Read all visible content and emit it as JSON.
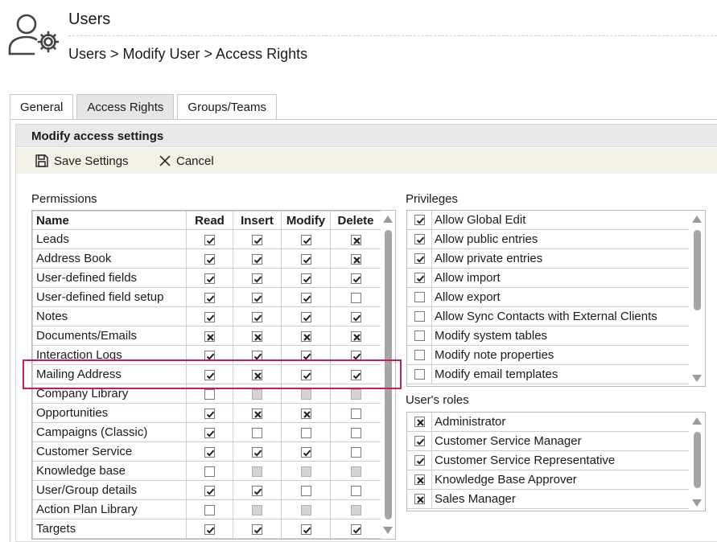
{
  "header": {
    "title": "Users",
    "breadcrumb": "Users > Modify User > Access Rights"
  },
  "tabs": [
    {
      "label": "General",
      "active": false
    },
    {
      "label": "Access Rights",
      "active": true
    },
    {
      "label": "Groups/Teams",
      "active": false
    }
  ],
  "panel": {
    "title": "Modify access settings",
    "save_label": "Save Settings",
    "cancel_label": "Cancel"
  },
  "permissions": {
    "label": "Permissions",
    "columns": [
      "Name",
      "Read",
      "Insert",
      "Modify",
      "Delete"
    ],
    "state_legend": {
      "c": "checked",
      "x": "crossed",
      "u": "unchecked",
      "d": "disabled"
    },
    "rows": [
      {
        "name": "Leads",
        "read": "c",
        "insert": "c",
        "modify": "c",
        "delete": "x"
      },
      {
        "name": "Address Book",
        "read": "c",
        "insert": "c",
        "modify": "c",
        "delete": "x"
      },
      {
        "name": "User-defined fields",
        "read": "c",
        "insert": "c",
        "modify": "c",
        "delete": "c"
      },
      {
        "name": "User-defined field setup",
        "read": "c",
        "insert": "c",
        "modify": "c",
        "delete": "u"
      },
      {
        "name": "Notes",
        "read": "c",
        "insert": "c",
        "modify": "c",
        "delete": "c"
      },
      {
        "name": "Documents/Emails",
        "read": "x",
        "insert": "x",
        "modify": "x",
        "delete": "x"
      },
      {
        "name": "Interaction Logs",
        "read": "c",
        "insert": "c",
        "modify": "c",
        "delete": "c"
      },
      {
        "name": "Mailing Address",
        "read": "c",
        "insert": "x",
        "modify": "c",
        "delete": "c"
      },
      {
        "name": "Company Library",
        "read": "u",
        "insert": "d",
        "modify": "d",
        "delete": "d"
      },
      {
        "name": "Opportunities",
        "read": "c",
        "insert": "x",
        "modify": "x",
        "delete": "u"
      },
      {
        "name": "Campaigns (Classic)",
        "read": "c",
        "insert": "u",
        "modify": "u",
        "delete": "u"
      },
      {
        "name": "Customer Service",
        "read": "c",
        "insert": "c",
        "modify": "c",
        "delete": "u"
      },
      {
        "name": "Knowledge base",
        "read": "u",
        "insert": "d",
        "modify": "d",
        "delete": "d"
      },
      {
        "name": "User/Group details",
        "read": "c",
        "insert": "c",
        "modify": "u",
        "delete": "u"
      },
      {
        "name": "Action Plan Library",
        "read": "u",
        "insert": "d",
        "modify": "d",
        "delete": "d"
      },
      {
        "name": "Targets",
        "read": "c",
        "insert": "c",
        "modify": "c",
        "delete": "c"
      }
    ]
  },
  "privileges": {
    "label": "Privileges",
    "items": [
      {
        "label": "Allow Global Edit",
        "state": "c"
      },
      {
        "label": "Allow public entries",
        "state": "c"
      },
      {
        "label": "Allow private entries",
        "state": "c"
      },
      {
        "label": "Allow import",
        "state": "c"
      },
      {
        "label": "Allow export",
        "state": "u"
      },
      {
        "label": "Allow Sync Contacts with External Clients",
        "state": "u"
      },
      {
        "label": "Modify system tables",
        "state": "u"
      },
      {
        "label": "Modify note properties",
        "state": "u"
      },
      {
        "label": "Modify email templates",
        "state": "u"
      }
    ]
  },
  "roles": {
    "label": "User's roles",
    "items": [
      {
        "label": "Administrator",
        "state": "x"
      },
      {
        "label": "Customer Service Manager",
        "state": "c"
      },
      {
        "label": "Customer Service Representative",
        "state": "c"
      },
      {
        "label": "Knowledge Base Approver",
        "state": "x"
      },
      {
        "label": "Sales Manager",
        "state": "x"
      }
    ]
  },
  "colors": {
    "highlight": "#c3224e",
    "panel_header": "#e9e9e9",
    "toolbar": "#f4f1e8",
    "active_tab": "#e6e6e6"
  },
  "icons": {
    "header": "user-gear-icon",
    "save": "floppy-disk-icon",
    "cancel": "close-icon"
  }
}
